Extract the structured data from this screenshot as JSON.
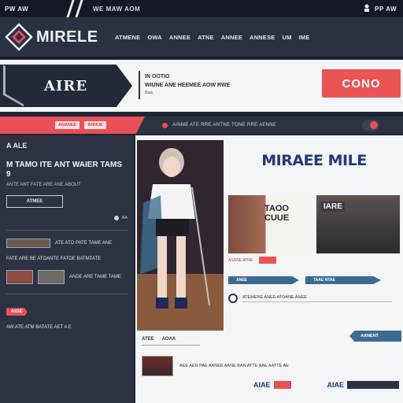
{
  "topstrip": {
    "left": "PW AW",
    "middle": "WE MAW AOM",
    "right": "PP AW"
  },
  "header": {
    "logo_text": "MIRELE",
    "nav": [
      "ATMENE",
      "OWA",
      "ANNEE",
      "ATNE",
      "ANNEE",
      "ANNESE",
      "UM",
      "IME"
    ]
  },
  "banner": {
    "badge_title": "AIRE",
    "text_line1": "IN OOTIO",
    "text_line2": "WIUNE ANE HEEMEE AOW RWE",
    "text_line3": "Baa",
    "cta": "CONO"
  },
  "subbar": {
    "pills": [
      "ANANEE",
      "ANNUE"
    ],
    "text": "AINME ATE RRE ANTNE TONE RRE AENNE"
  },
  "sidebar": {
    "title": "A ALE",
    "headline": "M TAMO ITE ANT WAIER TAMS 9",
    "sub": "ANTE ANT FATE ARE ANE ABOUT",
    "button": "ATMEE",
    "row_small": "AA",
    "news": [
      {
        "text": "ATE ATO PATE TAME ANE"
      },
      {
        "text": "FATE ARE BE ATOANTE FATOE BATMTATE"
      },
      {
        "text": "ANDE ARE TAME TAME"
      }
    ],
    "tag": "AIGE",
    "footer_text": "AW ATE ATM BATATE AET A E"
  },
  "main": {
    "brand_logo": "MIRAEE MILE",
    "card_a_title": "TAOO CUUE",
    "card_b_title": "IARE",
    "card_caption": "ASANE ATNE",
    "tabs": [
      "ANEE",
      "TAAE NTAE"
    ],
    "search_text": "ATEMENE ANEE ATOANE ANEE",
    "caption": [
      "ATEE",
      "AOAA"
    ],
    "blue_arrow": "AANENT",
    "news_text": "AEE AEN PAE AANEE AANE BAN ATTE AAE AATTE AE",
    "bottom_tags": [
      "AIAE",
      "AIAE"
    ]
  },
  "colors": {
    "accent_red": "#e84f58",
    "dark": "#2b3342",
    "blue": "#3a6c93",
    "brand_blue": "#1f3b7a"
  }
}
